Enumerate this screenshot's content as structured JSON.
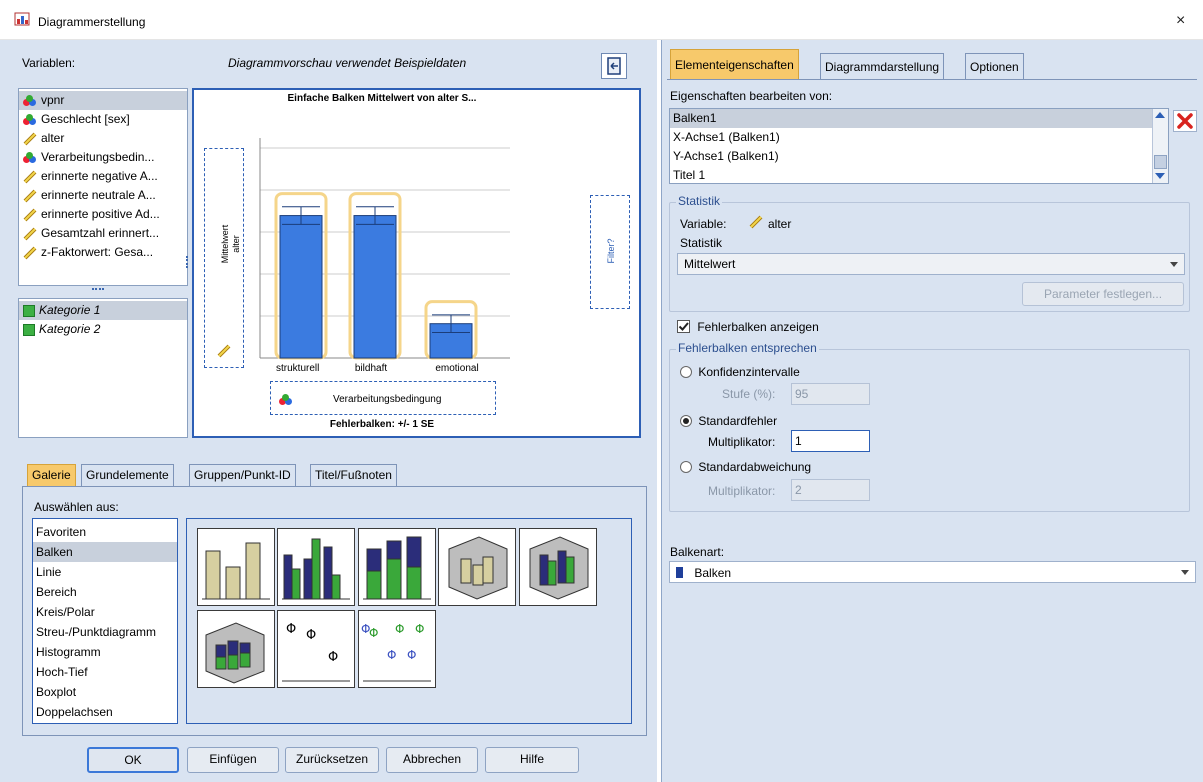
{
  "window": {
    "title": "Diagrammerstellung",
    "close_glyph": "×"
  },
  "left": {
    "variables_label": "Variablen:",
    "preview_note": "Diagrammvorschau verwendet Beispieldaten",
    "variables": [
      {
        "label": "vpnr",
        "icon": "nominal-icon"
      },
      {
        "label": "Geschlecht [sex]",
        "icon": "nominal-icon"
      },
      {
        "label": "alter",
        "icon": "scale-icon"
      },
      {
        "label": "Verarbeitungsbedin...",
        "icon": "nominal-icon"
      },
      {
        "label": "erinnerte negative A...",
        "icon": "scale-icon"
      },
      {
        "label": "erinnerte neutrale A...",
        "icon": "scale-icon"
      },
      {
        "label": "erinnerte positive Ad...",
        "icon": "scale-icon"
      },
      {
        "label": "Gesamtzahl erinnert...",
        "icon": "scale-icon"
      },
      {
        "label": "z-Faktorwert:  Gesa...",
        "icon": "scale-icon"
      }
    ],
    "categories": [
      {
        "label": "Kategorie 1"
      },
      {
        "label": "Kategorie 2"
      }
    ],
    "preview": {
      "title": "Einfache Balken Mittelwert  von alter S...",
      "y_axis_drop": "Mittelwert alter",
      "y_axis_line1": "Mittelwert",
      "y_axis_line2": "alter",
      "filter_drop": "Filter?",
      "x_axis_drop": "Verarbeitungsbedingung",
      "footnote": "Fehlerbalken: +/- 1 SE",
      "bars": [
        {
          "label": "strukturell",
          "value": 0.83,
          "err": 0.08
        },
        {
          "label": "bildhaft",
          "value": 0.83,
          "err": 0.08
        },
        {
          "label": "emotional",
          "value": 0.2,
          "err": 0.08
        }
      ]
    },
    "tabs": [
      "Galerie",
      "Grundelemente",
      "Gruppen/Punkt-ID",
      "Titel/Fußnoten"
    ],
    "choose_from_label": "Auswählen aus:",
    "gallery_items": [
      "Favoriten",
      "Balken",
      "Linie",
      "Bereich",
      "Kreis/Polar",
      "Streu-/Punktdiagramm",
      "Histogramm",
      "Hoch-Tief",
      "Boxplot",
      "Doppelachsen"
    ],
    "buttons": {
      "ok": "OK",
      "paste": "Einfügen",
      "reset": "Zurücksetzen",
      "cancel": "Abbrechen",
      "help": "Hilfe"
    }
  },
  "right": {
    "tabs": [
      "Elementeigenschaften",
      "Diagrammdarstellung",
      "Optionen"
    ],
    "edit_props_label": "Eigenschaften bearbeiten von:",
    "elements": [
      "Balken1",
      "X-Achse1 (Balken1)",
      "Y-Achse1 (Balken1)",
      "Titel 1"
    ],
    "statistics_group": "Statistik",
    "variable_label": "Variable:",
    "variable_value": "alter",
    "statistic_label": "Statistik",
    "statistic_value": "Mittelwert",
    "set_params_button": "Parameter festlegen...",
    "show_error_bars": "Fehlerbalken anzeigen",
    "error_bars_group": "Fehlerbalken entsprechen",
    "ci_label": "Konfidenzintervalle",
    "level_label": "Stufe (%):",
    "level_value": "95",
    "se_label": "Standardfehler",
    "multiplier_label": "Multiplikator:",
    "se_multiplier_value": "1",
    "sd_label": "Standardabweichung",
    "sd_multiplier_label": "Multiplikator:",
    "sd_multiplier_value": "2",
    "bar_type_label": "Balkenart:",
    "bar_type_value": "Balken"
  },
  "colors": {
    "bar_fill": "#3b7be0",
    "active_tab": "#f7c96b",
    "panel_bg": "#d9e3f1"
  }
}
